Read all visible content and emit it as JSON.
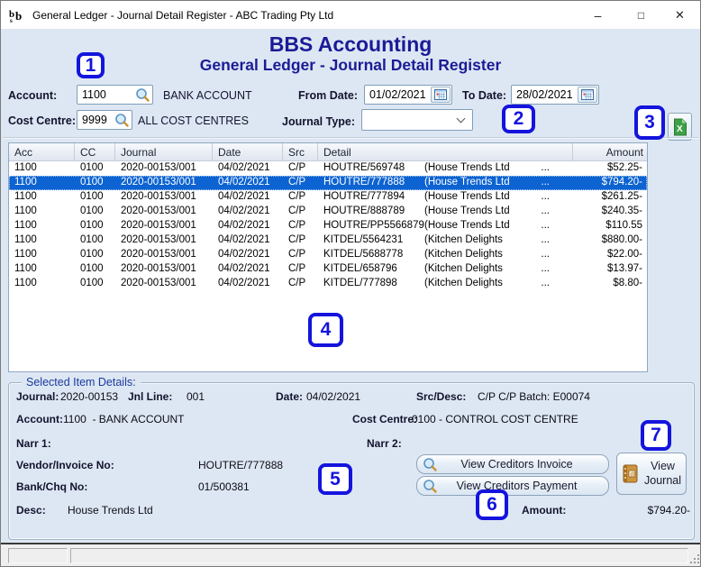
{
  "window": {
    "title": "General Ledger - Journal Detail Register - ABC Trading Pty Ltd"
  },
  "header": {
    "app_title": "BBS Accounting",
    "page_title": "General Ledger - Journal Detail Register"
  },
  "filters": {
    "account": {
      "label": "Account:",
      "value": "1100",
      "description": "BANK ACCOUNT"
    },
    "cost_centre": {
      "label": "Cost Centre:",
      "value": "9999",
      "description": "ALL COST CENTRES"
    },
    "from_date": {
      "label": "From Date:",
      "value": "01/02/2021"
    },
    "to_date": {
      "label": "To Date:",
      "value": "28/02/2021"
    },
    "journal_type": {
      "label": "Journal Type:",
      "value": ""
    }
  },
  "table": {
    "columns": [
      "Acc",
      "CC",
      "Journal",
      "Date",
      "Src",
      "Detail",
      "Amount"
    ],
    "rows": [
      {
        "acc": "1100",
        "cc": "0100",
        "journal": "2020-00153/001",
        "date": "04/02/2021",
        "src": "C/P",
        "ref": "HOUTRE/569748",
        "name": "(House Trends Ltd",
        "more": "...",
        "amount": "$52.25-",
        "selected": false
      },
      {
        "acc": "1100",
        "cc": "0100",
        "journal": "2020-00153/001",
        "date": "04/02/2021",
        "src": "C/P",
        "ref": "HOUTRE/777888",
        "name": "(House Trends Ltd",
        "more": "...",
        "amount": "$794.20-",
        "selected": true
      },
      {
        "acc": "1100",
        "cc": "0100",
        "journal": "2020-00153/001",
        "date": "04/02/2021",
        "src": "C/P",
        "ref": "HOUTRE/777894",
        "name": "(House Trends Ltd",
        "more": "...",
        "amount": "$261.25-",
        "selected": false
      },
      {
        "acc": "1100",
        "cc": "0100",
        "journal": "2020-00153/001",
        "date": "04/02/2021",
        "src": "C/P",
        "ref": "HOUTRE/888789",
        "name": "(House Trends Ltd",
        "more": "...",
        "amount": "$240.35-",
        "selected": false
      },
      {
        "acc": "1100",
        "cc": "0100",
        "journal": "2020-00153/001",
        "date": "04/02/2021",
        "src": "C/P",
        "ref": "HOUTRE/PP5566879",
        "name": "(House Trends Ltd",
        "more": "...",
        "amount": "$110.55",
        "selected": false
      },
      {
        "acc": "1100",
        "cc": "0100",
        "journal": "2020-00153/001",
        "date": "04/02/2021",
        "src": "C/P",
        "ref": "KITDEL/5564231",
        "name": "(Kitchen Delights",
        "more": "...",
        "amount": "$880.00-",
        "selected": false
      },
      {
        "acc": "1100",
        "cc": "0100",
        "journal": "2020-00153/001",
        "date": "04/02/2021",
        "src": "C/P",
        "ref": "KITDEL/5688778",
        "name": "(Kitchen Delights",
        "more": "...",
        "amount": "$22.00-",
        "selected": false
      },
      {
        "acc": "1100",
        "cc": "0100",
        "journal": "2020-00153/001",
        "date": "04/02/2021",
        "src": "C/P",
        "ref": "KITDEL/658796",
        "name": "(Kitchen Delights",
        "more": "...",
        "amount": "$13.97-",
        "selected": false
      },
      {
        "acc": "1100",
        "cc": "0100",
        "journal": "2020-00153/001",
        "date": "04/02/2021",
        "src": "C/P",
        "ref": "KITDEL/777898",
        "name": "(Kitchen Delights",
        "more": "...",
        "amount": "$8.80-",
        "selected": false
      }
    ]
  },
  "details": {
    "title": "Selected Item Details:",
    "fields": {
      "journal": {
        "label": "Journal:",
        "value": "2020-00153"
      },
      "jnl_line": {
        "label": "Jnl Line:",
        "value": "001"
      },
      "date": {
        "label": "Date:",
        "value": "04/02/2021"
      },
      "src_desc": {
        "label": "Src/Desc:",
        "value": "C/P C/P Batch: E00074"
      },
      "account": {
        "label": "Account:",
        "value": "1100  - BANK ACCOUNT"
      },
      "cost_centre": {
        "label": "Cost Centre:",
        "value": "0100 - CONTROL COST CENTRE"
      },
      "narr1": {
        "label": "Narr 1:",
        "value": ""
      },
      "narr2": {
        "label": "Narr 2:",
        "value": ""
      },
      "vendor_invoice_no": {
        "label": "Vendor/Invoice No:",
        "value": "HOUTRE/777888"
      },
      "bank_chq_no": {
        "label": "Bank/Chq No:",
        "value": "01/500381"
      },
      "desc": {
        "label": "Desc:",
        "value": "House Trends Ltd"
      },
      "amount": {
        "label": "Amount:",
        "value": "$794.20-"
      }
    },
    "buttons": {
      "view_creditors_invoice": "View Creditors Invoice",
      "view_creditors_payment": "View Creditors Payment",
      "view_journal": "View Journal"
    }
  },
  "annotations": {
    "a1": "1",
    "a2": "2",
    "a3": "3",
    "a4": "4",
    "a5": "5",
    "a6": "6",
    "a7": "7"
  },
  "icons": {
    "minimize": "–",
    "maximize": "□",
    "close": "✕"
  },
  "colors": {
    "annotation_blue": "#1414dd",
    "selection_blue": "#0d63d1",
    "title_navy": "#1b1b96",
    "excel_green": "#3fa045"
  }
}
